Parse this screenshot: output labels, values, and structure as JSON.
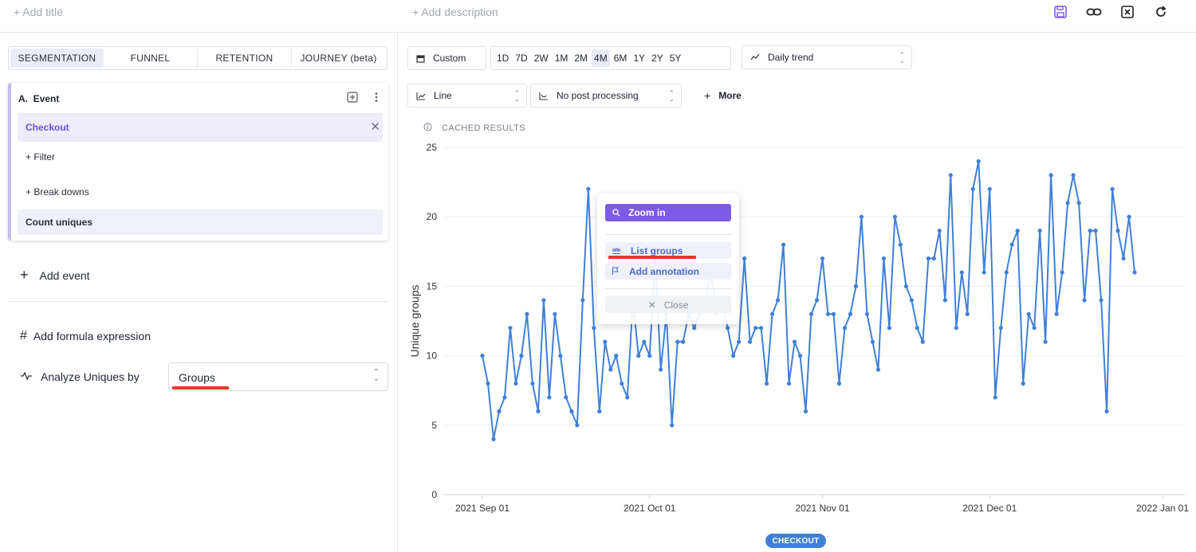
{
  "header": {
    "add_title": "+ Add title",
    "add_description": "+ Add description",
    "icons": [
      "save-icon",
      "link-icon",
      "close-box-icon",
      "refresh-icon"
    ]
  },
  "tabs": [
    "SEGMENTATION",
    "FUNNEL",
    "RETENTION",
    "JOURNEY (beta)"
  ],
  "event": {
    "header": "A.  Event",
    "name": "Checkout",
    "filter": "+ Filter",
    "breakdowns": "+ Break downs",
    "measure": "Count uniques"
  },
  "add_event": "Add event",
  "add_formula": "Add formula expression",
  "analyze_label": "Analyze Uniques by",
  "analyze_value": "Groups",
  "controls": {
    "date_mode": "Custom",
    "ranges": [
      "1D",
      "7D",
      "2W",
      "1M",
      "2M",
      "4M",
      "6M",
      "1Y",
      "2Y",
      "5Y"
    ],
    "active_range": "4M",
    "interval": "Daily trend",
    "chart_type": "Line",
    "post_processing": "No post processing",
    "more": "More"
  },
  "cached": "CACHED RESULTS",
  "popup": {
    "zoom": "Zoom in",
    "list_groups": "List groups",
    "add_annotation": "Add annotation",
    "close": "Close"
  },
  "colors": {
    "accent": "#7c5ce6",
    "line": "#3f80d8",
    "highlight": "#e8352a"
  },
  "chart_data": {
    "type": "line",
    "ylabel": "Unique groups",
    "ylim": [
      0,
      25
    ],
    "yticks": [
      0,
      5,
      10,
      15,
      20,
      25
    ],
    "xticks": [
      "2021 Sep 01",
      "2021 Oct 01",
      "2021 Nov 01",
      "2021 Dec 01",
      "2022 Jan 01"
    ],
    "series": [
      {
        "name": "CHECKOUT",
        "x_start": "2021-09-01",
        "values": [
          10,
          8,
          4,
          6,
          7,
          12,
          8,
          10,
          13,
          8,
          6,
          14,
          7,
          13,
          10,
          7,
          6,
          5,
          14,
          22,
          12,
          6,
          11,
          9,
          10,
          8,
          7,
          14,
          10,
          11,
          10,
          17,
          9,
          13,
          5,
          11,
          11,
          13,
          12,
          13,
          14,
          16,
          13,
          14,
          12,
          10,
          11,
          17,
          11,
          12,
          12,
          8,
          13,
          14,
          18,
          8,
          11,
          10,
          6,
          13,
          14,
          17,
          13,
          13,
          8,
          12,
          13,
          15,
          20,
          13,
          11,
          9,
          17,
          12,
          20,
          18,
          15,
          14,
          12,
          11,
          17,
          17,
          19,
          14,
          23,
          12,
          16,
          13,
          22,
          24,
          16,
          22,
          7,
          12,
          16,
          18,
          19,
          8,
          13,
          12,
          19,
          11,
          23,
          13,
          16,
          21,
          23,
          21,
          14,
          19,
          19,
          14,
          6,
          22,
          19,
          17,
          20,
          16
        ]
      }
    ]
  }
}
